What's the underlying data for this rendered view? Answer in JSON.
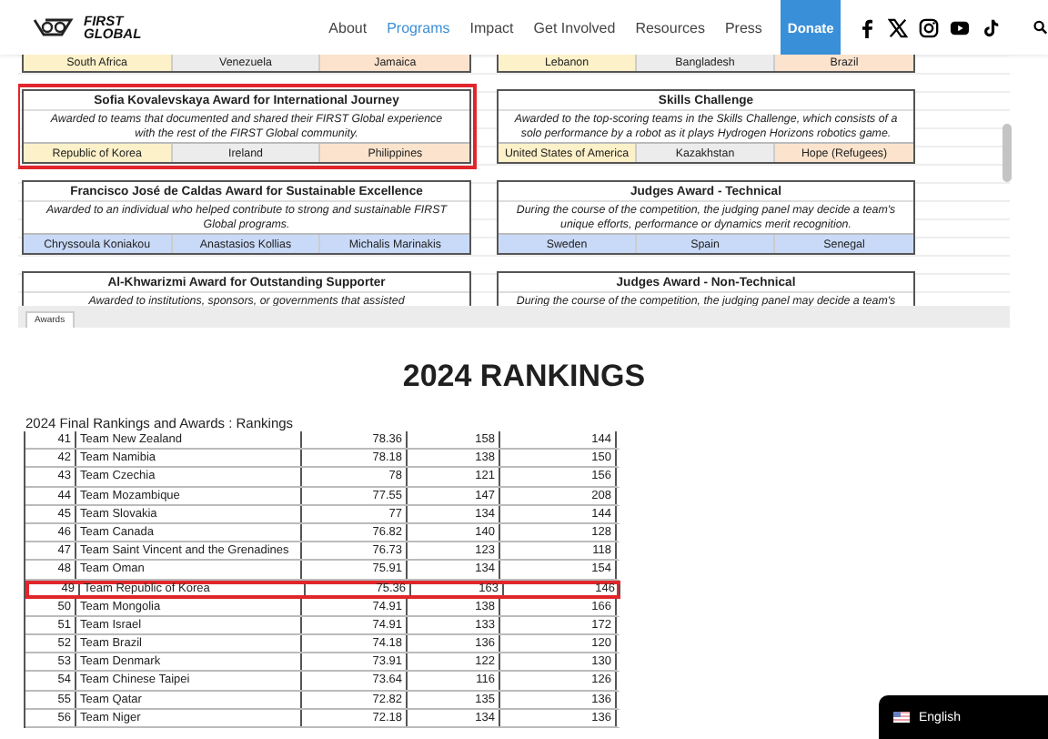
{
  "header": {
    "logo": {
      "line1": "FIRST",
      "line2": "GLOBAL"
    },
    "nav": [
      {
        "label": "About",
        "selected": false
      },
      {
        "label": "Programs",
        "selected": true
      },
      {
        "label": "Impact",
        "selected": false
      },
      {
        "label": "Get Involved",
        "selected": false
      },
      {
        "label": "Resources",
        "selected": false
      },
      {
        "label": "Press",
        "selected": false
      }
    ],
    "donate": "Donate",
    "social": [
      {
        "kind": "facebook"
      },
      {
        "kind": "x"
      },
      {
        "kind": "instagram"
      },
      {
        "kind": "youtube"
      },
      {
        "kind": "tiktok"
      }
    ]
  },
  "sheet": {
    "rows": [
      {
        "left": {
          "highlighted": false,
          "winners": [
            {
              "name": "South Africa",
              "color": "#fdf1c9"
            },
            {
              "name": "Venezuela",
              "color": "#ececec"
            },
            {
              "name": "Jamaica",
              "color": "#fbe3cd"
            }
          ]
        },
        "right": {
          "highlighted": false,
          "winners": [
            {
              "name": "Lebanon",
              "color": "#fdf1c9"
            },
            {
              "name": "Bangladesh",
              "color": "#ececec"
            },
            {
              "name": "Brazil",
              "color": "#fbe3cd"
            }
          ]
        }
      },
      {
        "left": {
          "highlighted": true,
          "title": "Sofia Kovalevskaya Award for International Journey",
          "lines": [
            "Awarded to teams that documented and shared their FIRST Global experience",
            "with the rest of the FIRST Global community."
          ],
          "winners": [
            {
              "name": "Republic of Korea",
              "color": "#fdf1c9"
            },
            {
              "name": "Ireland",
              "color": "#ececec"
            },
            {
              "name": "Philippines",
              "color": "#fbe3cd"
            }
          ]
        },
        "right": {
          "highlighted": false,
          "title": "Skills Challenge",
          "lines": [
            "Awarded to the top-scoring teams in the Skills Challenge, which consists of a",
            "solo performance by a robot as it plays Hydrogen Horizons robotics game."
          ],
          "winners": [
            {
              "name": "United States of America",
              "color": "#fdf1c9"
            },
            {
              "name": "Kazakhstan",
              "color": "#ececec"
            },
            {
              "name": "Hope (Refugees)",
              "color": "#fbe3cd"
            }
          ]
        }
      },
      {
        "left": {
          "highlighted": false,
          "title": "Francisco José de Caldas Award for Sustainable Excellence",
          "lines": [
            "Awarded to an individual who helped contribute to strong and sustainable FIRST",
            "Global programs."
          ],
          "winners": [
            {
              "name": "Chryssoula Koniakou",
              "color": "#c9daf8"
            },
            {
              "name": "Anastasios Kollias",
              "color": "#c9daf8"
            },
            {
              "name": "Michalis Marinakis",
              "color": "#c9daf8"
            }
          ]
        },
        "right": {
          "highlighted": false,
          "title": "Judges Award - Technical",
          "lines": [
            "During the course of the competition, the judging panel may decide a team's",
            "unique efforts, performance or dynamics merit recognition."
          ],
          "winners": [
            {
              "name": "Sweden",
              "color": "#c9daf8"
            },
            {
              "name": "Spain",
              "color": "#c9daf8"
            },
            {
              "name": "Senegal",
              "color": "#c9daf8"
            }
          ]
        }
      },
      {
        "left": {
          "highlighted": false,
          "title": "Al-Khwarizmi Award for Outstanding Supporter",
          "lines": [
            "Awarded to institutions, sponsors, or governments that assisted"
          ]
        },
        "right": {
          "highlighted": false,
          "title": "Judges Award - Non-Technical",
          "lines": [
            "During the course of the competition, the judging panel may decide a team's"
          ]
        }
      }
    ],
    "tabs": [
      {
        "label": "Awards",
        "selected": true
      }
    ]
  },
  "rankings": {
    "heading": "2024 RANKINGS",
    "caption": "2024 Final Rankings and Awards : Rankings",
    "rows": [
      {
        "rank": "41",
        "team": "Team New Zealand",
        "score": "78.36",
        "column_4": "158",
        "column_5": "144",
        "highlighted": false
      },
      {
        "rank": "42",
        "team": "Team Namibia",
        "score": "78.18",
        "column_4": "138",
        "column_5": "150",
        "highlighted": false
      },
      {
        "rank": "43",
        "team": "Team Czechia",
        "score": "78",
        "column_4": "121",
        "column_5": "156",
        "highlighted": false
      },
      {
        "rank": "44",
        "team": "Team Mozambique",
        "score": "77.55",
        "column_4": "147",
        "column_5": "208",
        "highlighted": false
      },
      {
        "rank": "45",
        "team": "Team Slovakia",
        "score": "77",
        "column_4": "134",
        "column_5": "144",
        "highlighted": false
      },
      {
        "rank": "46",
        "team": "Team Canada",
        "score": "76.82",
        "column_4": "140",
        "column_5": "128",
        "highlighted": false
      },
      {
        "rank": "47",
        "team": "Team Saint Vincent and the Grenadines",
        "score": "76.73",
        "column_4": "123",
        "column_5": "118",
        "highlighted": false
      },
      {
        "rank": "48",
        "team": "Team Oman",
        "score": "75.91",
        "column_4": "134",
        "column_5": "154",
        "highlighted": false
      },
      {
        "rank": "49",
        "team": "Team Republic of Korea",
        "score": "75.36",
        "column_4": "163",
        "column_5": "146",
        "highlighted": true
      },
      {
        "rank": "50",
        "team": "Team Mongolia",
        "score": "74.91",
        "column_4": "138",
        "column_5": "166",
        "highlighted": false
      },
      {
        "rank": "51",
        "team": "Team Israel",
        "score": "74.91",
        "column_4": "133",
        "column_5": "172",
        "highlighted": false
      },
      {
        "rank": "52",
        "team": "Team Brazil",
        "score": "74.18",
        "column_4": "136",
        "column_5": "120",
        "highlighted": false
      },
      {
        "rank": "53",
        "team": "Team Denmark",
        "score": "73.91",
        "column_4": "122",
        "column_5": "130",
        "highlighted": false
      },
      {
        "rank": "54",
        "team": "Team Chinese Taipei",
        "score": "73.64",
        "column_4": "116",
        "column_5": "126",
        "highlighted": false
      },
      {
        "rank": "55",
        "team": "Team Qatar",
        "score": "72.82",
        "column_4": "135",
        "column_5": "136",
        "highlighted": false
      },
      {
        "rank": "56",
        "team": "Team Niger",
        "score": "72.18",
        "column_4": "134",
        "column_5": "136",
        "highlighted": false
      }
    ]
  },
  "language": {
    "label": "English"
  }
}
